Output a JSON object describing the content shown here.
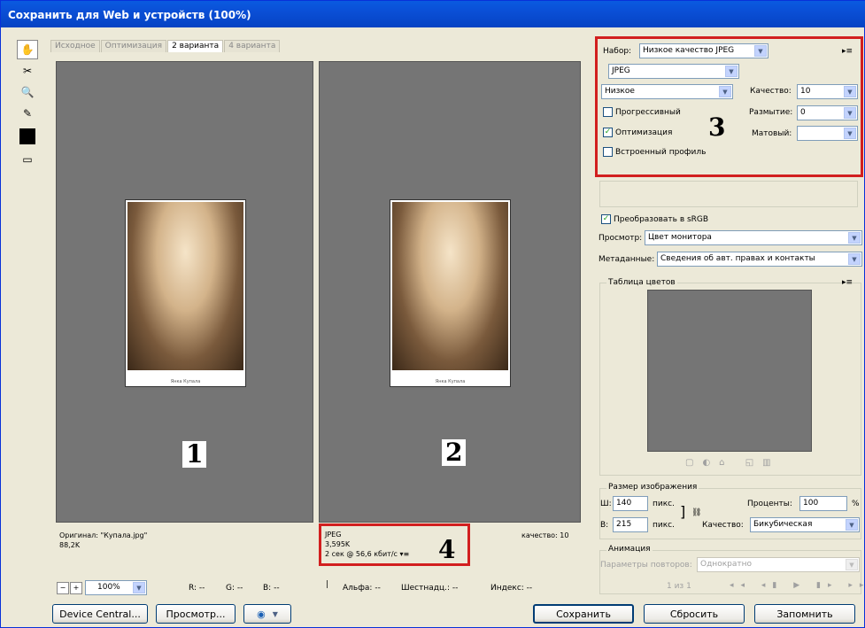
{
  "window": {
    "title": "Сохранить для Web и устройств (100%)"
  },
  "tabs": [
    "Исходное",
    "Оптимизация",
    "2 варианта",
    "4 варианта"
  ],
  "panes": [
    {
      "label": "1",
      "info": [
        "Оригинал: \"Купала.jpg\"",
        "88,2K"
      ],
      "caption": "Янка Купала"
    },
    {
      "label": "2",
      "info": [
        "JPEG",
        "3,595K",
        "2 сек @ 56,6 кбит/с"
      ],
      "quality": "качество: 10",
      "caption": "Янка Купала"
    }
  ],
  "annotations": {
    "n3": "3",
    "n4": "4"
  },
  "settings": {
    "preset_label": "Набор:",
    "preset_value": "Низкое качество JPEG",
    "format": "JPEG",
    "compression": "Низкое",
    "quality_label": "Качество:",
    "quality_value": "10",
    "blur_label": "Размытие:",
    "blur_value": "0",
    "matte_label": "Матовый:",
    "matte_value": "",
    "progressive": "Прогрессивный",
    "optimized": "Оптимизация",
    "embed_profile": "Встроенный профиль"
  },
  "convert": {
    "srgb": "Преобразовать в sRGB",
    "preview_label": "Просмотр:",
    "preview_value": "Цвет монитора",
    "metadata_label": "Метаданные:",
    "metadata_value": "Сведения об авт. правах и контакты"
  },
  "color_table": {
    "title": "Таблица цветов"
  },
  "image_size": {
    "title": "Размер изображения",
    "w_label": "Ш:",
    "w_value": "140",
    "h_label": "В:",
    "h_value": "215",
    "unit": "пикс.",
    "percent_label": "Проценты:",
    "percent_value": "100",
    "percent_sign": "%",
    "quality_label": "Качество:",
    "quality_value": "Бикубическая"
  },
  "animation": {
    "title": "Анимация",
    "loop_label": "Параметры повторов:",
    "loop_value": "Однократно",
    "frame": "1 из 1"
  },
  "statusbar": {
    "zoom": "100%",
    "r": "R: --",
    "g": "G: --",
    "b": "B: --",
    "alpha": "Альфа: --",
    "hex": "Шестнадц.: --",
    "index": "Индекс: --"
  },
  "buttons": {
    "device_central": "Device Central...",
    "preview": "Просмотр...",
    "save": "Сохранить",
    "reset": "Сбросить",
    "remember": "Запомнить"
  }
}
